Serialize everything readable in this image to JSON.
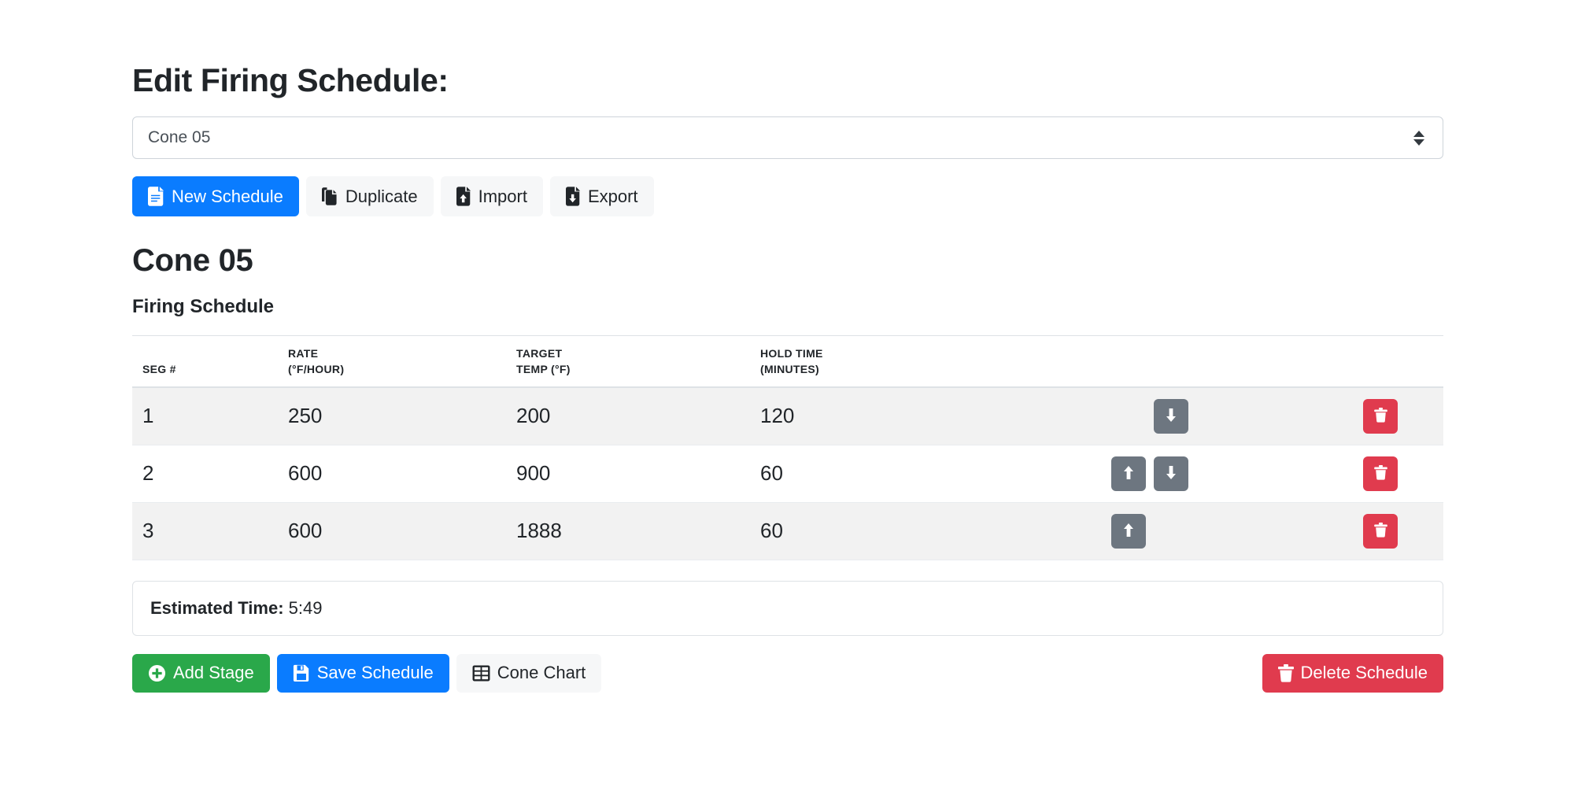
{
  "page": {
    "title": "Edit Firing Schedule:"
  },
  "schedule_select": {
    "value": "Cone 05",
    "options": [
      "Cone 05"
    ]
  },
  "toolbar": {
    "new_schedule": {
      "label": "New Schedule",
      "icon": "file-lines-icon"
    },
    "duplicate": {
      "label": "Duplicate",
      "icon": "copy-icon"
    },
    "import": {
      "label": "Import",
      "icon": "file-import-icon"
    },
    "export": {
      "label": "Export",
      "icon": "file-export-icon"
    }
  },
  "schedule": {
    "name": "Cone 05",
    "section_title": "Firing Schedule",
    "columns": {
      "seg": {
        "line1": "",
        "line2": "SEG #"
      },
      "rate": {
        "line1": "RATE",
        "line2": "(°F/HOUR)"
      },
      "temp": {
        "line1": "TARGET",
        "line2": "TEMP (°F)"
      },
      "hold": {
        "line1": "HOLD TIME",
        "line2": "(MINUTES)"
      }
    },
    "rows": [
      {
        "seg": "1",
        "rate": "250",
        "temp": "200",
        "hold": "120",
        "move_up": false,
        "move_down": true
      },
      {
        "seg": "2",
        "rate": "600",
        "temp": "900",
        "hold": "60",
        "move_up": true,
        "move_down": true
      },
      {
        "seg": "3",
        "rate": "600",
        "temp": "1888",
        "hold": "60",
        "move_up": true,
        "move_down": false
      }
    ]
  },
  "estimated_time": {
    "label": "Estimated Time:",
    "value": "5:49"
  },
  "actions": {
    "add_stage": {
      "label": "Add Stage",
      "icon": "plus-circle-icon"
    },
    "save_schedule": {
      "label": "Save Schedule",
      "icon": "floppy-disk-icon"
    },
    "cone_chart": {
      "label": "Cone Chart",
      "icon": "table-icon"
    },
    "delete_schedule": {
      "label": "Delete Schedule",
      "icon": "trash-icon"
    }
  },
  "colors": {
    "primary": "#0a7cff",
    "success": "#2aa84a",
    "danger": "#e03b4e",
    "secondary": "#6d7680",
    "light": "#f6f7f8",
    "stripe": "#f2f2f2",
    "border": "#dee2e6"
  }
}
